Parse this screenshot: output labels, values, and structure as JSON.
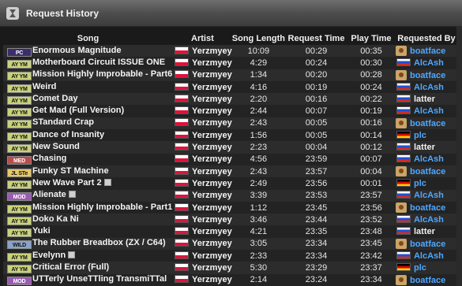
{
  "panel": {
    "title": "Request History"
  },
  "columns": [
    "Song",
    "Artist",
    "Song Length",
    "Request Time",
    "Play Time",
    "Requested By"
  ],
  "rows": [
    {
      "format": "PC",
      "song": "Enormous Magnitude",
      "dl": false,
      "artist": "Yerzmyey",
      "length": "10:09",
      "req_time": "00:29",
      "play_time": "00:35",
      "user": "boatface",
      "user_flag": "avatar"
    },
    {
      "format": "AY YM",
      "song": "Motherboard Circuit ISSUE ONE",
      "dl": false,
      "artist": "Yerzmyey",
      "length": "4:29",
      "req_time": "00:24",
      "play_time": "00:30",
      "user": "AlcAsh",
      "user_flag": "ru"
    },
    {
      "format": "AY YM",
      "song": "Mission Highly Improbable - Part6",
      "dl": false,
      "artist": "Yerzmyey",
      "length": "1:34",
      "req_time": "00:20",
      "play_time": "00:28",
      "user": "boatface",
      "user_flag": "avatar"
    },
    {
      "format": "AY YM",
      "song": "Weird",
      "dl": false,
      "artist": "Yerzmyey",
      "length": "4:16",
      "req_time": "00:19",
      "play_time": "00:24",
      "user": "AlcAsh",
      "user_flag": "ru"
    },
    {
      "format": "AY YM",
      "song": "Comet Day",
      "dl": false,
      "artist": "Yerzmyey",
      "length": "2:20",
      "req_time": "00:16",
      "play_time": "00:22",
      "user": "latter",
      "user_flag": "ru"
    },
    {
      "format": "AY YM",
      "song": "Get Mad (Full Version)",
      "dl": false,
      "artist": "Yerzmyey",
      "length": "2:44",
      "req_time": "00:07",
      "play_time": "00:19",
      "user": "AlcAsh",
      "user_flag": "ru"
    },
    {
      "format": "AY YM",
      "song": "STandard Crap",
      "dl": false,
      "artist": "Yerzmyey",
      "length": "2:43",
      "req_time": "00:05",
      "play_time": "00:16",
      "user": "boatface",
      "user_flag": "avatar"
    },
    {
      "format": "AY YM",
      "song": "Dance of Insanity",
      "dl": false,
      "artist": "Yerzmyey",
      "length": "1:56",
      "req_time": "00:05",
      "play_time": "00:14",
      "user": "plc",
      "user_flag": "de"
    },
    {
      "format": "AY YM",
      "song": "New Sound",
      "dl": false,
      "artist": "Yerzmyey",
      "length": "2:23",
      "req_time": "00:04",
      "play_time": "00:12",
      "user": "latter",
      "user_flag": "ru"
    },
    {
      "format": "MED",
      "song": "Chasing",
      "dl": false,
      "artist": "Yerzmyey",
      "length": "4:56",
      "req_time": "23:59",
      "play_time": "00:07",
      "user": "AlcAsh",
      "user_flag": "ru"
    },
    {
      "format": "JL STe",
      "song": "Funky ST Machine",
      "dl": false,
      "artist": "Yerzmyey",
      "length": "2:43",
      "req_time": "23:57",
      "play_time": "00:04",
      "user": "boatface",
      "user_flag": "avatar"
    },
    {
      "format": "AY YM",
      "song": "New Wave Part 2",
      "dl": true,
      "artist": "Yerzmyey",
      "length": "2:49",
      "req_time": "23:56",
      "play_time": "00:01",
      "user": "plc",
      "user_flag": "de"
    },
    {
      "format": "MOD",
      "song": "Alienate",
      "dl": true,
      "artist": "Yerzmyey",
      "length": "3:39",
      "req_time": "23:53",
      "play_time": "23:57",
      "user": "AlcAsh",
      "user_flag": "ru"
    },
    {
      "format": "AY YM",
      "song": "Mission Highly Improbable - Part1",
      "dl": false,
      "artist": "Yerzmyey",
      "length": "1:12",
      "req_time": "23:45",
      "play_time": "23:56",
      "user": "boatface",
      "user_flag": "avatar"
    },
    {
      "format": "AY YM",
      "song": "Doko Ka Ni",
      "dl": false,
      "artist": "Yerzmyey",
      "length": "3:46",
      "req_time": "23:44",
      "play_time": "23:52",
      "user": "AlcAsh",
      "user_flag": "ru"
    },
    {
      "format": "AY YM",
      "song": "Yuki",
      "dl": false,
      "artist": "Yerzmyey",
      "length": "4:21",
      "req_time": "23:35",
      "play_time": "23:48",
      "user": "latter",
      "user_flag": "ru"
    },
    {
      "format": "WILD",
      "song": "The Rubber Breadbox (ZX / C64)",
      "dl": false,
      "artist": "Yerzmyey",
      "length": "3:05",
      "req_time": "23:34",
      "play_time": "23:45",
      "user": "boatface",
      "user_flag": "avatar"
    },
    {
      "format": "AY YM",
      "song": "Evelynn",
      "dl": true,
      "artist": "Yerzmyey",
      "length": "2:33",
      "req_time": "23:34",
      "play_time": "23:42",
      "user": "AlcAsh",
      "user_flag": "ru"
    },
    {
      "format": "AY YM",
      "song": "Critical Error (Full)",
      "dl": false,
      "artist": "Yerzmyey",
      "length": "5:30",
      "req_time": "23:29",
      "play_time": "23:37",
      "user": "plc",
      "user_flag": "de"
    },
    {
      "format": "MOD",
      "song": "UTTerly UnseTTling TransmiTTal",
      "dl": false,
      "artist": "Yerzmyey",
      "length": "2:14",
      "req_time": "23:24",
      "play_time": "23:34",
      "user": "boatface",
      "user_flag": "avatar"
    }
  ],
  "colors": {
    "link": "#4fa7ff",
    "row_a": "#2c2c2c",
    "row_b": "#232323"
  }
}
